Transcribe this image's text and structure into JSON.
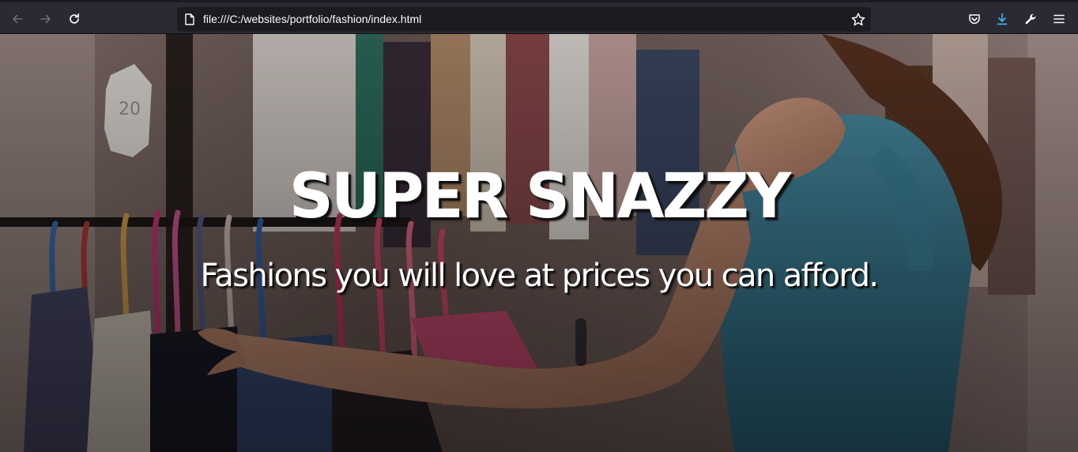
{
  "browser": {
    "address_url": "file:///C:/websites/portfolio/fashion/index.html",
    "icons": {
      "back": "arrow-left-icon",
      "forward": "arrow-right-icon",
      "reload": "reload-icon",
      "page": "page-icon",
      "bookmark": "star-icon",
      "pocket": "pocket-icon",
      "downloads": "download-icon",
      "tools": "wrench-icon",
      "menu": "hamburger-menu-icon"
    },
    "colors": {
      "toolbar": "#2b2a33",
      "urlbar": "#1c1b22",
      "download_accent": "#3fb2e4"
    }
  },
  "hero": {
    "title": "SUPER SNAZZY",
    "subtitle": "Fashions you will love at prices you can afford.",
    "hang_tag_text": "20"
  }
}
